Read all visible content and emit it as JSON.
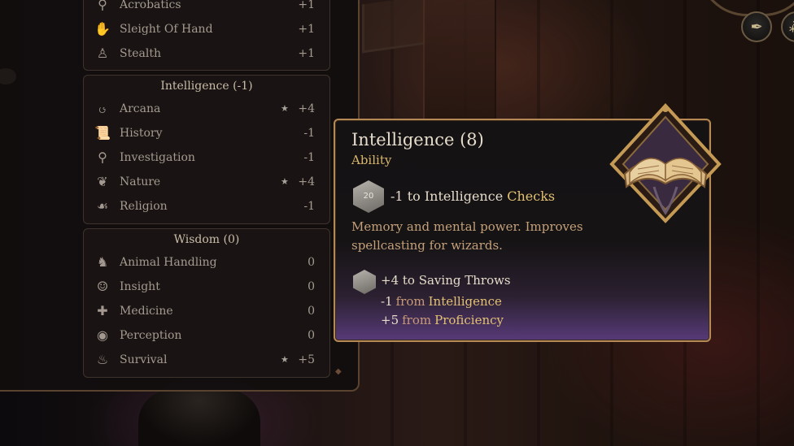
{
  "skills": {
    "top_rows": [
      {
        "label": "Acrobatics",
        "value": "+1",
        "icon": "acrobat-figure-icon",
        "proficient": false
      },
      {
        "label": "Sleight Of Hand",
        "value": "+1",
        "icon": "grabbing-hand-icon",
        "proficient": false
      },
      {
        "label": "Stealth",
        "value": "+1",
        "icon": "hooded-figure-icon",
        "proficient": false
      }
    ],
    "intelligence": {
      "title": "Intelligence (-1)",
      "rows": [
        {
          "label": "Arcana",
          "value": "+4",
          "icon": "arcane-swirl-icon",
          "proficient": true
        },
        {
          "label": "History",
          "value": "-1",
          "icon": "scroll-icon",
          "proficient": false
        },
        {
          "label": "Investigation",
          "value": "-1",
          "icon": "magnifier-icon",
          "proficient": false
        },
        {
          "label": "Nature",
          "value": "+4",
          "icon": "leaf-icon",
          "proficient": true
        },
        {
          "label": "Religion",
          "value": "-1",
          "icon": "praying-hands-icon",
          "proficient": false
        }
      ]
    },
    "wisdom": {
      "title": "Wisdom (0)",
      "rows": [
        {
          "label": "Animal Handling",
          "value": "0",
          "icon": "horse-head-icon",
          "proficient": false
        },
        {
          "label": "Insight",
          "value": "0",
          "icon": "head-profile-icon",
          "proficient": false
        },
        {
          "label": "Medicine",
          "value": "0",
          "icon": "bandage-icon",
          "proficient": false
        },
        {
          "label": "Perception",
          "value": "0",
          "icon": "eye-icon",
          "proficient": false
        },
        {
          "label": "Survival",
          "value": "+5",
          "icon": "campfire-icon",
          "proficient": true
        }
      ]
    },
    "proficient_glyph": "★"
  },
  "tooltip": {
    "title": "Intelligence (8)",
    "subtitle": "Ability",
    "check_value": "-1",
    "check_text": "to Intelligence",
    "check_gold": "Checks",
    "die_label": "20",
    "description": "Memory and mental power. Improves spellcasting for wizards.",
    "saving_throw": "+4 to Saving Throws",
    "modifiers": [
      {
        "value": "-1",
        "from": "from",
        "source": "Intelligence"
      },
      {
        "value": "+5",
        "from": "from",
        "source": "Proficiency"
      }
    ]
  },
  "colors": {
    "gold_accent": "#e3c173",
    "tooltip_border": "#b58956",
    "tooltip_purple": "#573a78"
  }
}
